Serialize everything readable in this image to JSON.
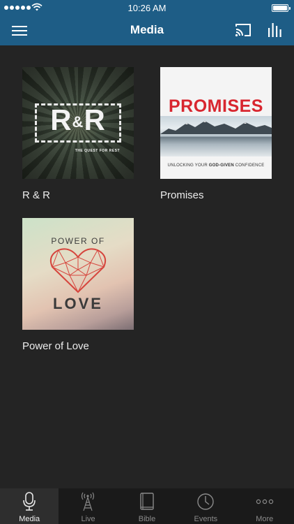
{
  "status_bar": {
    "time": "10:26 AM"
  },
  "header": {
    "title": "Media"
  },
  "media": {
    "items": [
      {
        "title": "R & R",
        "art_title": "R&R",
        "art_subtitle": "THE QUEST FOR REST"
      },
      {
        "title": "Promises",
        "art_title": "PROMISES",
        "art_subtitle_pre": "UNLOCKING YOUR ",
        "art_subtitle_bold": "GOD-GIVEN",
        "art_subtitle_post": " CONFIDENCE"
      },
      {
        "title": "Power of Love",
        "art_top": "POWER OF",
        "art_bottom": "LOVE"
      }
    ]
  },
  "tabs": [
    {
      "label": "Media",
      "icon": "microphone-icon",
      "active": true
    },
    {
      "label": "Live",
      "icon": "broadcast-tower-icon",
      "active": false
    },
    {
      "label": "Bible",
      "icon": "book-icon",
      "active": false
    },
    {
      "label": "Events",
      "icon": "clock-icon",
      "active": false
    },
    {
      "label": "More",
      "icon": "more-dots-icon",
      "active": false
    }
  ],
  "colors": {
    "header": "#1e5d86",
    "background": "#242424",
    "tabbar": "#1a1a1a",
    "accent_red": "#d8262f"
  }
}
